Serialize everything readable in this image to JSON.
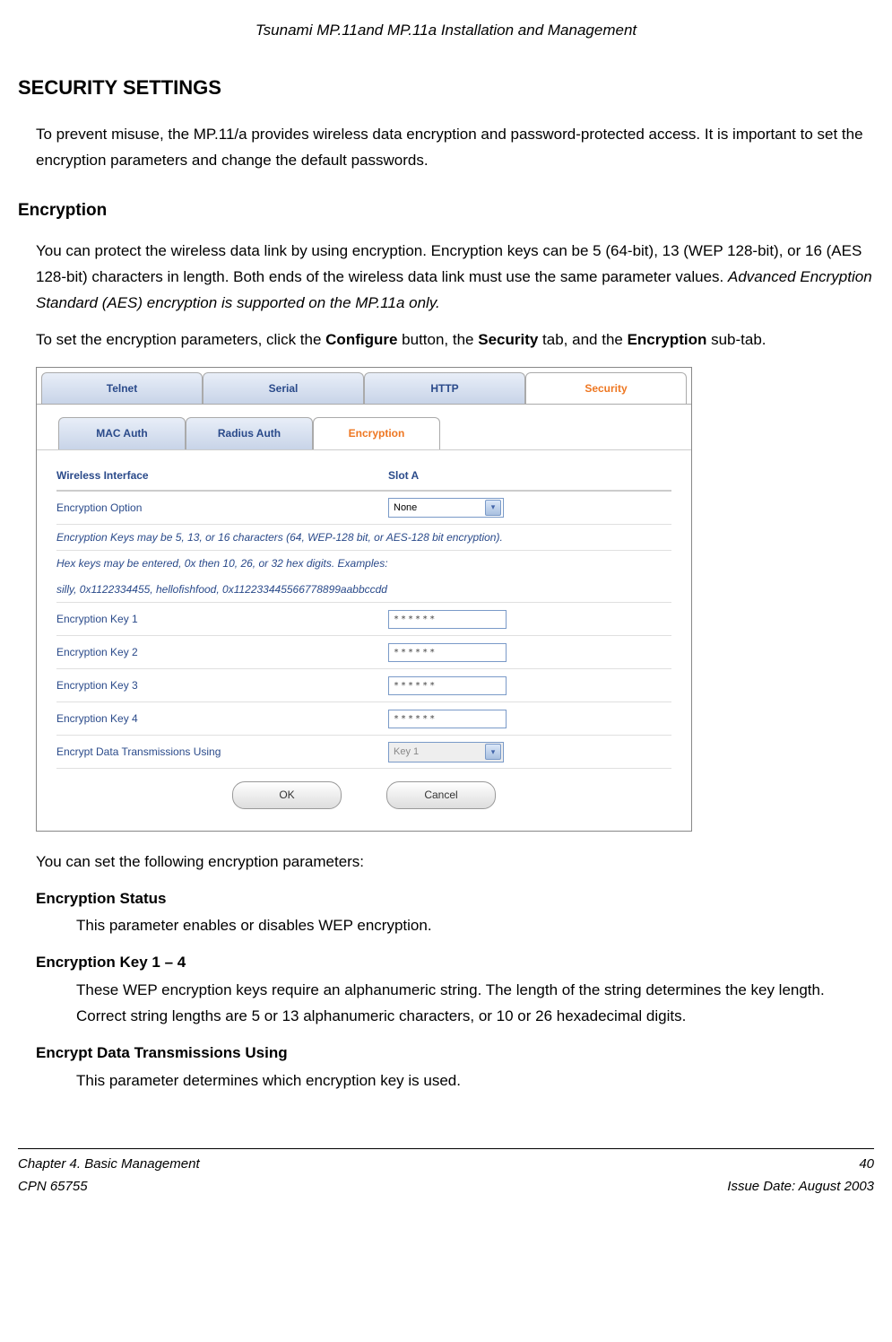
{
  "header": {
    "title": "Tsunami MP.11and MP.11a Installation and Management"
  },
  "h1": "SECURITY SETTINGS",
  "intro": "To prevent misuse, the MP.11/a provides wireless data encryption and password-protected access. It is important to set the encryption parameters and change the default passwords.",
  "h2": "Encryption",
  "encryption_para_1": "You can protect the wireless data link by using encryption.   Encryption keys can be 5 (64-bit), 13 (WEP 128-bit), or 16 (AES 128-bit) characters in length.  Both ends of the wireless data link must use the same parameter values. ",
  "encryption_para_1_italic": "Advanced Encryption Standard (AES) encryption is supported on the MP.11a only.",
  "encryption_para_2_a": "To set the encryption parameters, click the ",
  "encryption_para_2_b": "Configure",
  "encryption_para_2_c": " button, the ",
  "encryption_para_2_d": "Security",
  "encryption_para_2_e": " tab, and the ",
  "encryption_para_2_f": "Encryption",
  "encryption_para_2_g": " sub-tab.",
  "screenshot": {
    "tabs_top": [
      "Telnet",
      "Serial",
      "HTTP",
      "Security"
    ],
    "tabs_top_active": 3,
    "tabs_sub": [
      "MAC Auth",
      "Radius Auth",
      "Encryption"
    ],
    "tabs_sub_active": 2,
    "header_left": "Wireless Interface",
    "header_right": "Slot A",
    "rows": {
      "option_label": "Encryption Option",
      "option_value": "None",
      "note1": "Encryption Keys may be 5, 13, or 16 characters (64, WEP-128 bit, or AES-128 bit encryption).",
      "note2": "Hex keys may be entered, 0x then 10, 26, or 32 hex digits. Examples:",
      "note3": "silly, 0x1122334455, hellofishfood, 0x112233445566778899aabbccdd",
      "key1": "Encryption Key 1",
      "key2": "Encryption Key 2",
      "key3": "Encryption Key 3",
      "key4": "Encryption Key 4",
      "key_mask": "******",
      "using_label": "Encrypt Data Transmissions Using",
      "using_value": "Key 1",
      "ok": "OK",
      "cancel": "Cancel"
    }
  },
  "after_shot": "You can set the following encryption parameters:",
  "params": [
    {
      "title": "Encryption Status",
      "text": "This parameter enables or disables WEP encryption."
    },
    {
      "title": "Encryption Key 1 – 4",
      "text": "These WEP encryption keys require an alphanumeric string. The length of the string determines the key length.  Correct string lengths are 5 or 13 alphanumeric characters, or 10 or 26 hexadecimal digits."
    },
    {
      "title": "Encrypt Data Transmissions Using",
      "text": "This parameter determines which encryption key is used."
    }
  ],
  "footer": {
    "left1": "Chapter 4.  Basic Management",
    "left2": "CPN 65755",
    "right1": "40",
    "right2": "Issue Date:  August 2003"
  }
}
